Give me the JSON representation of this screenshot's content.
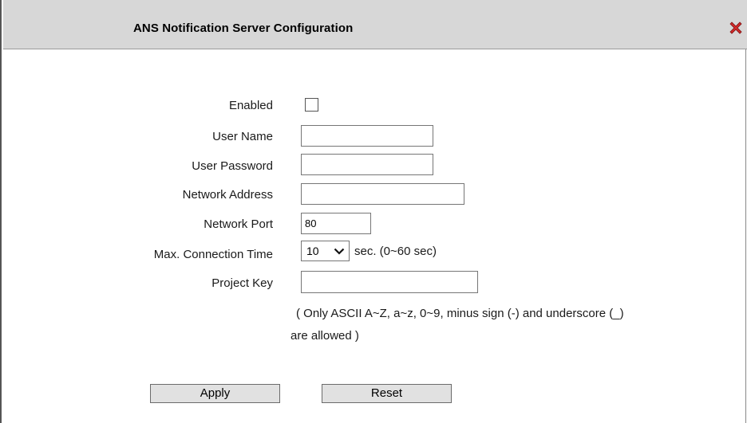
{
  "dialog": {
    "title": "ANS Notification Server Configuration",
    "close_icon": "close-x-icon"
  },
  "form": {
    "enabled_label": "Enabled",
    "enabled_checked": false,
    "user_name_label": "User Name",
    "user_name_value": "",
    "user_password_label": "User Password",
    "user_password_value": "",
    "network_address_label": "Network Address",
    "network_address_value": "",
    "network_port_label": "Network Port",
    "network_port_value": "80",
    "max_connection_time_label": "Max. Connection Time",
    "max_connection_time_value": "10",
    "max_connection_time_suffix": "sec. (0~60 sec)",
    "project_key_label": "Project Key",
    "project_key_value": "",
    "note_line1": "( Only ASCII A~Z, a~z, 0~9, minus sign (-) and underscore (_)",
    "note_line2": "are allowed )"
  },
  "buttons": {
    "apply_label": "Apply",
    "reset_label": "Reset"
  },
  "colors": {
    "titlebar_bg": "#d7d7d7",
    "close_icon": "#d42a2a",
    "button_bg": "#e1e1e1"
  }
}
